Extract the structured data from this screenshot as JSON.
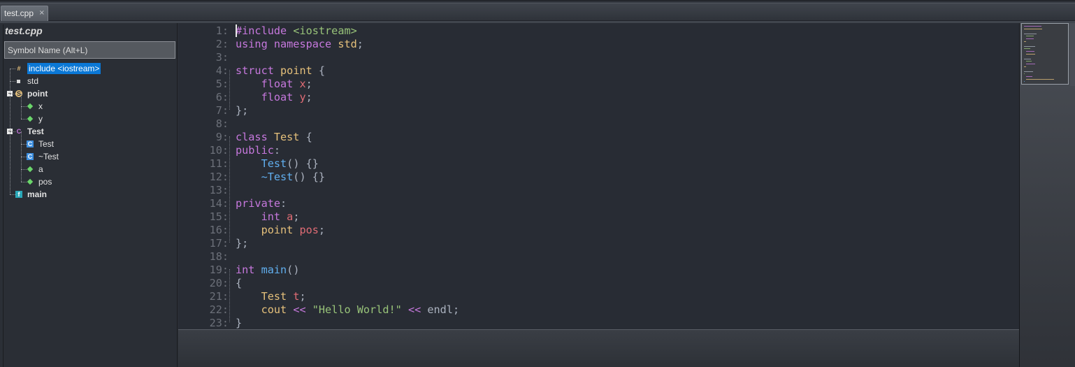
{
  "tab": {
    "label": "test.cpp",
    "close_glyph": "×"
  },
  "panel": {
    "title": "test.cpp",
    "search_placeholder": "Symbol Name (Alt+L)",
    "items": [
      {
        "label": "include <iostream>",
        "icon": "hash-icon",
        "selected": true
      },
      {
        "label": "std",
        "icon": "namespace-icon"
      },
      {
        "label": "point",
        "icon": "struct-icon",
        "bold": true
      },
      {
        "label": "x",
        "icon": "field-icon"
      },
      {
        "label": "y",
        "icon": "field-icon"
      },
      {
        "label": "Test",
        "icon": "class-icon",
        "bold": true
      },
      {
        "label": "Test",
        "icon": "method-icon"
      },
      {
        "label": "~Test",
        "icon": "method-icon"
      },
      {
        "label": "a",
        "icon": "field-icon"
      },
      {
        "label": "pos",
        "icon": "field-icon"
      },
      {
        "label": "main",
        "icon": "function-icon",
        "bold": true
      }
    ]
  },
  "editor": {
    "lines": [
      "#include <iostream>",
      "using namespace std;",
      "",
      "struct point {",
      "    float x;",
      "    float y;",
      "};",
      "",
      "class Test {",
      "public:",
      "    Test() {}",
      "    ~Test() {}",
      "",
      "private:",
      "    int a;",
      "    point pos;",
      "};",
      "",
      "int main()",
      "{",
      "    Test t;",
      "    cout << \"Hello World!\" << endl;",
      "}"
    ]
  },
  "colors": {
    "keyword": "#c678dd",
    "type": "#e5c07b",
    "string": "#98c379",
    "function": "#61afef",
    "variable": "#e06c75",
    "plain": "#abb2bf",
    "line_number": "#6c7079",
    "selection": "#0b78d6"
  }
}
